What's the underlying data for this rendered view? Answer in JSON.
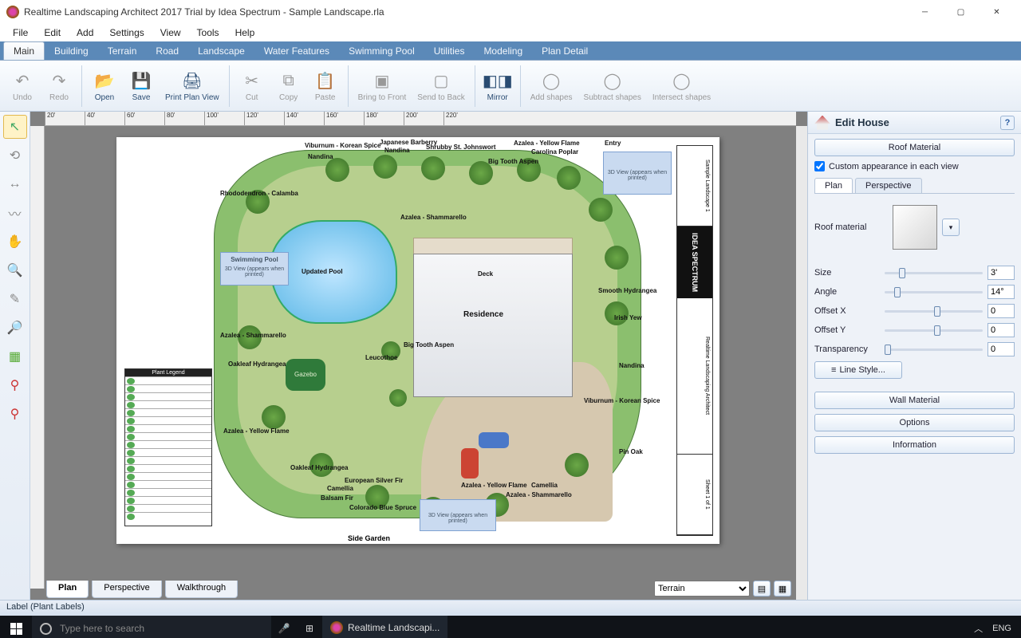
{
  "window": {
    "title": "Realtime Landscaping Architect 2017 Trial by Idea Spectrum - Sample Landscape.rla"
  },
  "menu": [
    "File",
    "Edit",
    "Add",
    "Settings",
    "View",
    "Tools",
    "Help"
  ],
  "tabs": [
    "Main",
    "Building",
    "Terrain",
    "Road",
    "Landscape",
    "Water Features",
    "Swimming Pool",
    "Utilities",
    "Modeling",
    "Plan Detail"
  ],
  "active_tab": "Main",
  "ribbon": {
    "undo": "Undo",
    "redo": "Redo",
    "open": "Open",
    "save": "Save",
    "print": "Print Plan View",
    "cut": "Cut",
    "copy": "Copy",
    "paste": "Paste",
    "btf": "Bring to Front",
    "stb": "Send to Back",
    "mirror": "Mirror",
    "add": "Add shapes",
    "sub": "Subtract shapes",
    "int": "Intersect shapes"
  },
  "ruler_marks": [
    "20'",
    "40'",
    "60'",
    "80'",
    "100'",
    "120'",
    "140'",
    "160'",
    "180'",
    "200'",
    "220'"
  ],
  "drawing": {
    "pool_label": "Updated Pool",
    "deck_label": "Deck",
    "residence_label": "Residence",
    "gazebo": "Gazebo",
    "side_garden": "Side Garden",
    "viewbox_text": "3D View (appears when printed)",
    "swimming_pool": "Swimming Pool",
    "entry": "Entry",
    "legend_title": "Plant Legend",
    "title_block": {
      "proj": "Sample Landscape 1",
      "co": "IDEA SPECTRUM",
      "prod": "Realtime Landscaping Architect",
      "sheet": "Sheet 1 of 1"
    },
    "labels": [
      "Viburnum - Korean Spice",
      "Japanese Barberry",
      "Nandina",
      "Shrubby St. Johnswort",
      "Azalea - Yellow Flame",
      "Carolina Poplar",
      "Nandina",
      "Big Tooth Aspen",
      "Rhododendron - Calamba",
      "Azalea - Shammarello",
      "Leucothoe",
      "Big Tooth Aspen",
      "Smooth Hydrangea",
      "Irish Yew",
      "Azalea - Shammarello",
      "Oakleaf Hydrangea",
      "Nandina",
      "Azalea - Yellow Flame",
      "Oakleaf Hydrangea",
      "Camellia",
      "European Silver Fir",
      "Balsam Fir",
      "Colorado Blue Spruce",
      "Azalea - Shammarello",
      "Azalea - Yellow Flame",
      "Camellia",
      "Pin Oak",
      "Viburnum - Korean Spice"
    ]
  },
  "view_tabs": [
    "Plan",
    "Perspective",
    "Walkthrough"
  ],
  "active_view_tab": "Plan",
  "terrain_dropdown": "Terrain",
  "right_panel": {
    "title": "Edit House",
    "roof_material_btn": "Roof Material",
    "custom_appearance": "Custom appearance in each view",
    "subtabs": [
      "Plan",
      "Perspective"
    ],
    "roof_material_label": "Roof material",
    "props": {
      "size": {
        "label": "Size",
        "value": "3'"
      },
      "angle": {
        "label": "Angle",
        "value": "14°"
      },
      "offx": {
        "label": "Offset X",
        "value": "0"
      },
      "offy": {
        "label": "Offset Y",
        "value": "0"
      },
      "transp": {
        "label": "Transparency",
        "value": "0"
      }
    },
    "line_style": "Line Style...",
    "wall_material": "Wall Material",
    "options": "Options",
    "information": "Information"
  },
  "status": "Label (Plant Labels)",
  "taskbar": {
    "search_placeholder": "Type here to search",
    "app": "Realtime Landscapi...",
    "lang": "ENG"
  }
}
